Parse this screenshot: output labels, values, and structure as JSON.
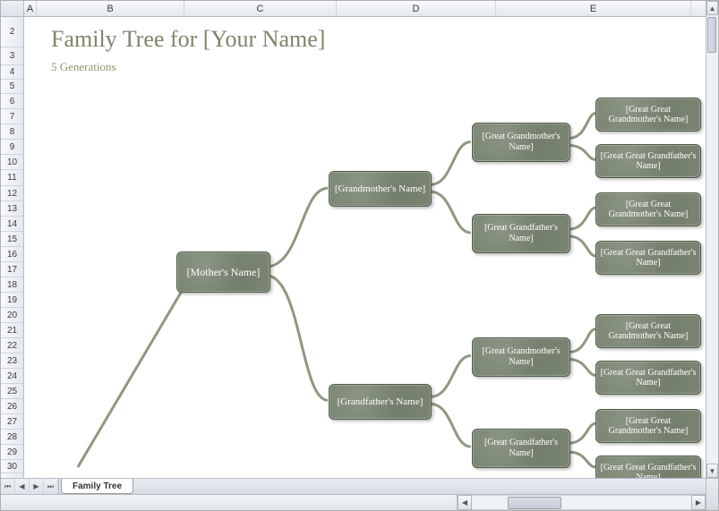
{
  "columns": {
    "A": "A",
    "B": "B",
    "C": "C",
    "D": "D",
    "E": "E"
  },
  "rows": {
    "r2": "2",
    "r3": "3",
    "r4": "4",
    "r5": "5",
    "r6": "6",
    "r7": "7",
    "r8": "8",
    "r9": "9",
    "r10": "10",
    "r11": "11",
    "r12": "12",
    "r13": "13",
    "r14": "14",
    "r15": "15",
    "r16": "16",
    "r17": "17",
    "r18": "18",
    "r19": "19",
    "r20": "20",
    "r21": "21",
    "r22": "22",
    "r23": "23",
    "r24": "24",
    "r25": "25",
    "r26": "26",
    "r27": "27",
    "r28": "28",
    "r29": "29",
    "r30": "30"
  },
  "title": "Family Tree for [Your Name]",
  "subtitle": "5 Generations",
  "tree": {
    "mother": "[Mother's Name]",
    "grandmother": "[Grandmother's Name]",
    "grandfather": "[Grandfather's Name]",
    "ggm1": "[Great Grandmother's Name]",
    "ggf1": "[Great Grandfather's Name]",
    "ggm2": "[Great Grandmother's Name]",
    "ggf2": "[Great Grandfather's Name]",
    "gggm1": "[Great Great Grandmother's Name]",
    "gggf1": "[Great Great Grandfather's Name]",
    "gggm2": "[Great Great Grandmother's Name]",
    "gggf2": "[Great Great Grandfather's Name]",
    "gggm3": "[Great Great Grandmother's Name]",
    "gggf3": "[Great Great Grandfather's Name]",
    "gggm4": "[Great Great Grandmother's Name]",
    "gggf4": "[Great Great Grandfather's Name]"
  },
  "sheet_tab": "Family Tree",
  "nav": {
    "first": "⏮",
    "prev": "◀",
    "next": "▶",
    "last": "⏭"
  },
  "scroll": {
    "left": "◀",
    "right": "▶",
    "up": "▲",
    "down": "▼"
  }
}
